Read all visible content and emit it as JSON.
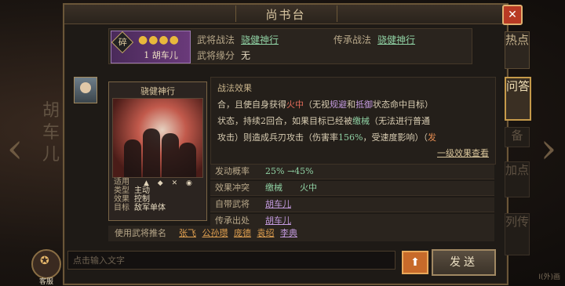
{
  "window": {
    "title": "尚书台"
  },
  "background": {
    "hero_name_vertical": "胡车儿",
    "nav_left": "‹",
    "nav_right": "›"
  },
  "top_card": {
    "general_name": "1 胡车儿",
    "stars": "●●●●",
    "badge": "碎",
    "war_method_label": "武将战法",
    "war_method_value": "骁健神行",
    "inherit_method_label": "传承战法",
    "inherit_method_value": "骁健神行",
    "fate_label": "武将缘分",
    "fate_value": "无"
  },
  "side_tabs": [
    "热点",
    "问答",
    "备",
    "加点",
    "列传"
  ],
  "skill_card": {
    "name": "骁健神行",
    "meta": [
      {
        "k": "适用",
        "v": ""
      },
      {
        "k": "类型",
        "v": "主动"
      },
      {
        "k": "效果",
        "v": "控制"
      },
      {
        "k": "目标",
        "v": "敌军单体"
      }
    ]
  },
  "effect": {
    "header": "战法效果",
    "line1_a": "合，且使自身获得",
    "line1_b": "火中",
    "line1_c": "（无视",
    "line1_d": "规避",
    "line1_e": "和",
    "line1_f": "抵御",
    "line1_g": "状态命中目标）",
    "line2_a": "状态，持续2回合，如果目标已经被",
    "line2_b": "缴械",
    "line2_c": "（无法进行普通",
    "line3_a": "攻击）则造成兵刃攻击（伤害率",
    "line3_b": "156%",
    "line3_c": "，受速度影响）（",
    "line3_d": "发",
    "more_link": "一级效果查看"
  },
  "stats": [
    {
      "k": "发动概率",
      "v": "25% →45%"
    },
    {
      "k": "效果冲突",
      "v": "缴械　　火中"
    },
    {
      "k": "自带武将",
      "v": "胡车儿"
    },
    {
      "k": "传承出处",
      "v": "胡车儿"
    }
  ],
  "users": {
    "label": "使用武将推名",
    "names": [
      "张飞",
      "公孙瓒",
      "庞德",
      "袁绍",
      "李典"
    ]
  },
  "input": {
    "placeholder": "点击输入文字",
    "send_label": "发送",
    "service_label": "客服"
  },
  "corner": "I(外)画"
}
